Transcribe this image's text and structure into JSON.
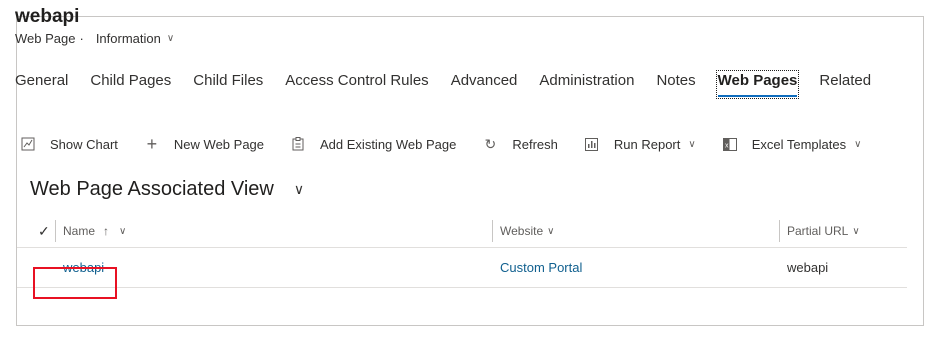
{
  "header": {
    "title": "webapi",
    "entity": "Web Page",
    "separator": "·",
    "form_name": "Information"
  },
  "tabs": [
    {
      "label": "General"
    },
    {
      "label": "Child Pages"
    },
    {
      "label": "Child Files"
    },
    {
      "label": "Access Control Rules"
    },
    {
      "label": "Advanced"
    },
    {
      "label": "Administration"
    },
    {
      "label": "Notes"
    },
    {
      "label": "Web Pages",
      "active": true
    },
    {
      "label": "Related"
    }
  ],
  "commands": {
    "show_chart": "Show Chart",
    "new_web_page": "New Web Page",
    "add_existing": "Add Existing Web Page",
    "refresh": "Refresh",
    "run_report": "Run Report",
    "excel_templates": "Excel Templates"
  },
  "view": {
    "title": "Web Page Associated View"
  },
  "grid": {
    "columns": {
      "name": "Name",
      "website": "Website",
      "partial_url": "Partial URL"
    },
    "rows": [
      {
        "name": "webapi",
        "website": "Custom Portal",
        "partial_url": "webapi"
      }
    ]
  },
  "colors": {
    "link": "#11608f",
    "highlight": "#e81123",
    "active_tab_underline": "#0f6cbd"
  }
}
